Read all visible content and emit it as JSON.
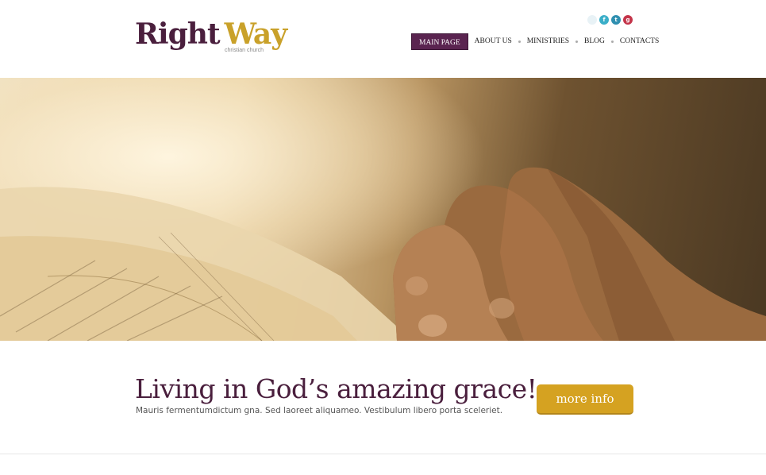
{
  "brand": {
    "word1": "Right",
    "word2": "Way",
    "tagline": "christian church"
  },
  "social": [
    {
      "icon": "blank-social-icon",
      "glyph": ""
    },
    {
      "icon": "facebook-icon",
      "glyph": "f"
    },
    {
      "icon": "twitter-icon",
      "glyph": "t"
    },
    {
      "icon": "google-plus-icon",
      "glyph": "g"
    }
  ],
  "nav": {
    "items": [
      {
        "label": "MAIN PAGE",
        "active": true
      },
      {
        "label": "ABOUT US"
      },
      {
        "label": "MINISTRIES"
      },
      {
        "label": "BLOG"
      },
      {
        "label": "CONTACTS"
      }
    ]
  },
  "hero": {
    "image": "open bible and praying hands photo"
  },
  "promo": {
    "title": "Living in God’s amazing grace!",
    "text": "Mauris fermentumdictum gna.  Sed laoreet aliquameo. Vestibulum libero porta sceleriet.",
    "button_label": "more info"
  },
  "colors": {
    "brand_purple": "#4a1f3d",
    "nav_active": "#5a2450",
    "accent_gold": "#d5a221"
  }
}
